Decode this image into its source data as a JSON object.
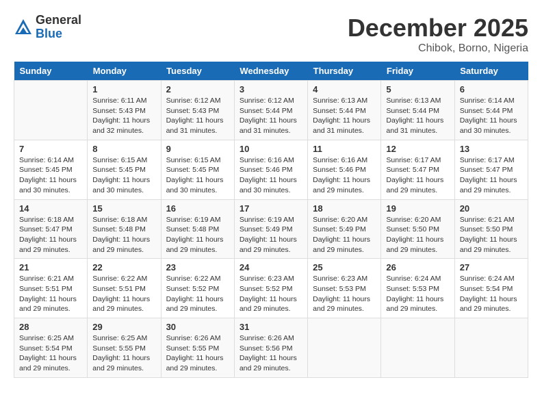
{
  "logo": {
    "general": "General",
    "blue": "Blue"
  },
  "title": "December 2025",
  "location": "Chibok, Borno, Nigeria",
  "days_header": [
    "Sunday",
    "Monday",
    "Tuesday",
    "Wednesday",
    "Thursday",
    "Friday",
    "Saturday"
  ],
  "weeks": [
    [
      {
        "day": "",
        "info": ""
      },
      {
        "day": "1",
        "info": "Sunrise: 6:11 AM\nSunset: 5:43 PM\nDaylight: 11 hours\nand 32 minutes."
      },
      {
        "day": "2",
        "info": "Sunrise: 6:12 AM\nSunset: 5:43 PM\nDaylight: 11 hours\nand 31 minutes."
      },
      {
        "day": "3",
        "info": "Sunrise: 6:12 AM\nSunset: 5:44 PM\nDaylight: 11 hours\nand 31 minutes."
      },
      {
        "day": "4",
        "info": "Sunrise: 6:13 AM\nSunset: 5:44 PM\nDaylight: 11 hours\nand 31 minutes."
      },
      {
        "day": "5",
        "info": "Sunrise: 6:13 AM\nSunset: 5:44 PM\nDaylight: 11 hours\nand 31 minutes."
      },
      {
        "day": "6",
        "info": "Sunrise: 6:14 AM\nSunset: 5:44 PM\nDaylight: 11 hours\nand 30 minutes."
      }
    ],
    [
      {
        "day": "7",
        "info": "Sunrise: 6:14 AM\nSunset: 5:45 PM\nDaylight: 11 hours\nand 30 minutes."
      },
      {
        "day": "8",
        "info": "Sunrise: 6:15 AM\nSunset: 5:45 PM\nDaylight: 11 hours\nand 30 minutes."
      },
      {
        "day": "9",
        "info": "Sunrise: 6:15 AM\nSunset: 5:45 PM\nDaylight: 11 hours\nand 30 minutes."
      },
      {
        "day": "10",
        "info": "Sunrise: 6:16 AM\nSunset: 5:46 PM\nDaylight: 11 hours\nand 30 minutes."
      },
      {
        "day": "11",
        "info": "Sunrise: 6:16 AM\nSunset: 5:46 PM\nDaylight: 11 hours\nand 29 minutes."
      },
      {
        "day": "12",
        "info": "Sunrise: 6:17 AM\nSunset: 5:47 PM\nDaylight: 11 hours\nand 29 minutes."
      },
      {
        "day": "13",
        "info": "Sunrise: 6:17 AM\nSunset: 5:47 PM\nDaylight: 11 hours\nand 29 minutes."
      }
    ],
    [
      {
        "day": "14",
        "info": "Sunrise: 6:18 AM\nSunset: 5:47 PM\nDaylight: 11 hours\nand 29 minutes."
      },
      {
        "day": "15",
        "info": "Sunrise: 6:18 AM\nSunset: 5:48 PM\nDaylight: 11 hours\nand 29 minutes."
      },
      {
        "day": "16",
        "info": "Sunrise: 6:19 AM\nSunset: 5:48 PM\nDaylight: 11 hours\nand 29 minutes."
      },
      {
        "day": "17",
        "info": "Sunrise: 6:19 AM\nSunset: 5:49 PM\nDaylight: 11 hours\nand 29 minutes."
      },
      {
        "day": "18",
        "info": "Sunrise: 6:20 AM\nSunset: 5:49 PM\nDaylight: 11 hours\nand 29 minutes."
      },
      {
        "day": "19",
        "info": "Sunrise: 6:20 AM\nSunset: 5:50 PM\nDaylight: 11 hours\nand 29 minutes."
      },
      {
        "day": "20",
        "info": "Sunrise: 6:21 AM\nSunset: 5:50 PM\nDaylight: 11 hours\nand 29 minutes."
      }
    ],
    [
      {
        "day": "21",
        "info": "Sunrise: 6:21 AM\nSunset: 5:51 PM\nDaylight: 11 hours\nand 29 minutes."
      },
      {
        "day": "22",
        "info": "Sunrise: 6:22 AM\nSunset: 5:51 PM\nDaylight: 11 hours\nand 29 minutes."
      },
      {
        "day": "23",
        "info": "Sunrise: 6:22 AM\nSunset: 5:52 PM\nDaylight: 11 hours\nand 29 minutes."
      },
      {
        "day": "24",
        "info": "Sunrise: 6:23 AM\nSunset: 5:52 PM\nDaylight: 11 hours\nand 29 minutes."
      },
      {
        "day": "25",
        "info": "Sunrise: 6:23 AM\nSunset: 5:53 PM\nDaylight: 11 hours\nand 29 minutes."
      },
      {
        "day": "26",
        "info": "Sunrise: 6:24 AM\nSunset: 5:53 PM\nDaylight: 11 hours\nand 29 minutes."
      },
      {
        "day": "27",
        "info": "Sunrise: 6:24 AM\nSunset: 5:54 PM\nDaylight: 11 hours\nand 29 minutes."
      }
    ],
    [
      {
        "day": "28",
        "info": "Sunrise: 6:25 AM\nSunset: 5:54 PM\nDaylight: 11 hours\nand 29 minutes."
      },
      {
        "day": "29",
        "info": "Sunrise: 6:25 AM\nSunset: 5:55 PM\nDaylight: 11 hours\nand 29 minutes."
      },
      {
        "day": "30",
        "info": "Sunrise: 6:26 AM\nSunset: 5:55 PM\nDaylight: 11 hours\nand 29 minutes."
      },
      {
        "day": "31",
        "info": "Sunrise: 6:26 AM\nSunset: 5:56 PM\nDaylight: 11 hours\nand 29 minutes."
      },
      {
        "day": "",
        "info": ""
      },
      {
        "day": "",
        "info": ""
      },
      {
        "day": "",
        "info": ""
      }
    ]
  ]
}
